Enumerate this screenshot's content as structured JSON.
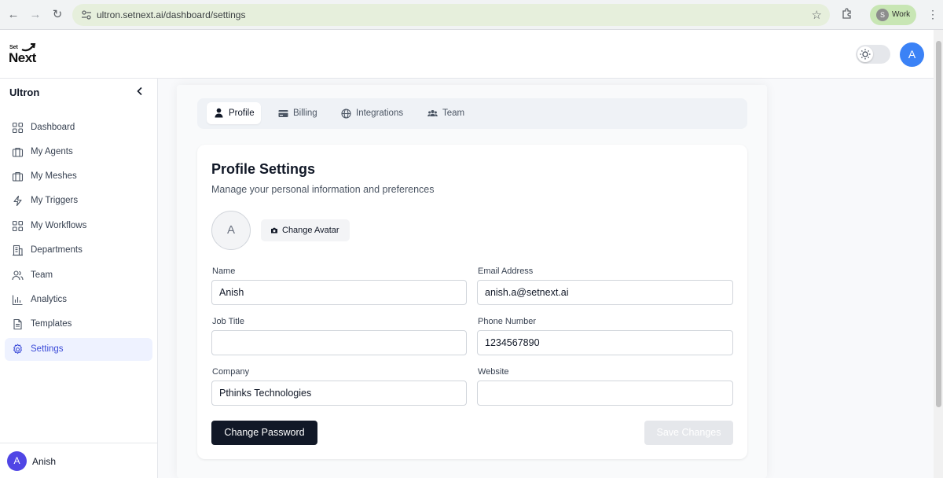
{
  "browser": {
    "url": "ultron.setnext.ai/dashboard/settings",
    "profile_initial": "S",
    "profile_label": "Work"
  },
  "header": {
    "logo_top": "Set",
    "logo_bottom": "Next",
    "avatar_initial": "A"
  },
  "sidebar": {
    "title": "Ultron",
    "items": [
      {
        "label": "Dashboard",
        "icon": "grid-icon"
      },
      {
        "label": "My Agents",
        "icon": "briefcase-icon"
      },
      {
        "label": "My Meshes",
        "icon": "briefcase-icon"
      },
      {
        "label": "My Triggers",
        "icon": "lightning-icon"
      },
      {
        "label": "My Workflows",
        "icon": "grid-icon"
      },
      {
        "label": "Departments",
        "icon": "building-icon"
      },
      {
        "label": "Team",
        "icon": "users-icon"
      },
      {
        "label": "Analytics",
        "icon": "bar-chart-icon"
      },
      {
        "label": "Templates",
        "icon": "document-icon"
      },
      {
        "label": "Settings",
        "icon": "gear-icon",
        "active": true
      }
    ],
    "user": {
      "initial": "A",
      "name": "Anish"
    }
  },
  "tabs": [
    {
      "label": "Profile",
      "active": true
    },
    {
      "label": "Billing"
    },
    {
      "label": "Integrations"
    },
    {
      "label": "Team"
    }
  ],
  "profile": {
    "title": "Profile Settings",
    "subtitle": "Manage your personal information and preferences",
    "avatar_initial": "A",
    "change_avatar": "Change Avatar",
    "fields": {
      "name": {
        "label": "Name",
        "value": "Anish"
      },
      "email": {
        "label": "Email Address",
        "value": "anish.a@setnext.ai"
      },
      "job_title": {
        "label": "Job Title",
        "value": ""
      },
      "phone": {
        "label": "Phone Number",
        "value": "1234567890"
      },
      "company": {
        "label": "Company",
        "value": "Pthinks Technologies"
      },
      "website": {
        "label": "Website",
        "value": ""
      }
    },
    "change_password": "Change Password",
    "save_changes": "Save Changes"
  },
  "colors": {
    "accent": "#3b4bd8",
    "active_bg": "#eef2ff",
    "primary_button": "#111827",
    "avatar_blue": "#3b82f6"
  }
}
